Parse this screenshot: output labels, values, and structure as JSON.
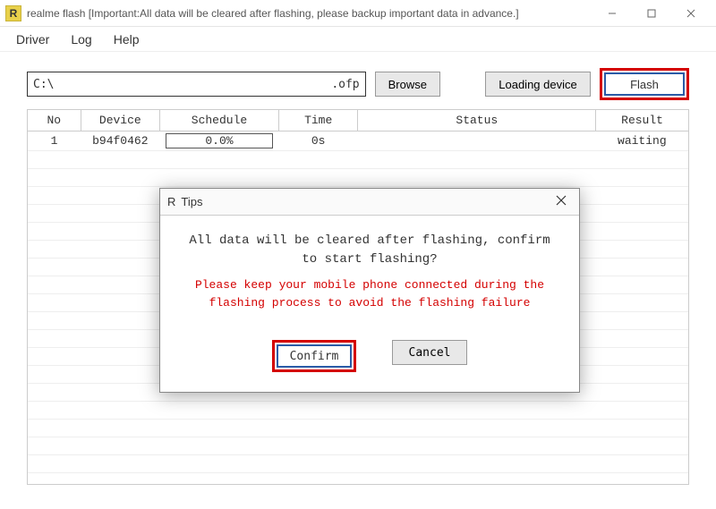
{
  "window": {
    "app_icon_letter": "R",
    "title": "realme flash [Important:All data will be cleared after flashing, please backup important data in advance.]"
  },
  "menu": {
    "driver": "Driver",
    "log": "Log",
    "help": "Help"
  },
  "toolbar": {
    "path_left": "C:\\",
    "path_ext": ".ofp",
    "browse": "Browse",
    "loading_device": "Loading device",
    "flash": "Flash"
  },
  "table": {
    "headers": {
      "no": "No",
      "device": "Device",
      "schedule": "Schedule",
      "time": "Time",
      "status": "Status",
      "result": "Result"
    },
    "rows": [
      {
        "no": "1",
        "device": "b94f0462",
        "schedule": "0.0%",
        "time": "0s",
        "status": "",
        "result": "waiting"
      }
    ]
  },
  "modal": {
    "icon_letter": "R",
    "title": "Tips",
    "message": "All data will be cleared after flashing, confirm to start flashing?",
    "warning": "Please keep your mobile phone connected during the flashing process to avoid the flashing failure",
    "confirm": "Confirm",
    "cancel": "Cancel"
  }
}
